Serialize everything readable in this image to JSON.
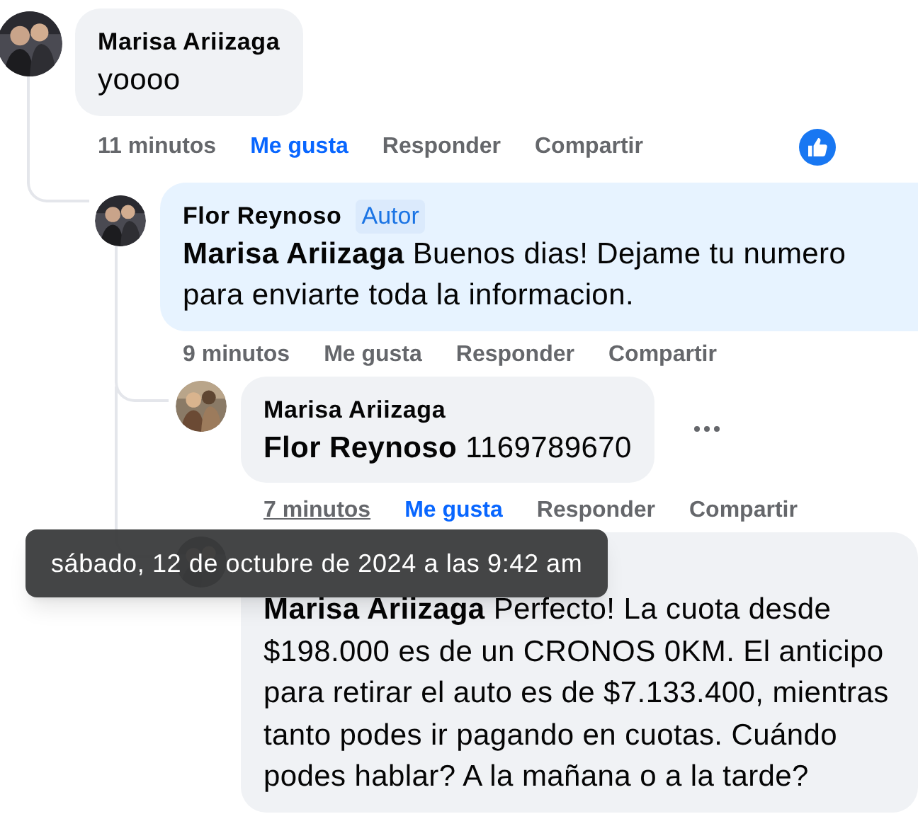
{
  "comments": [
    {
      "author": "Marisa Ariizaga",
      "text": "yoooo",
      "time": "11 minutos",
      "time_hovered": false,
      "liked": true,
      "like_label": "Me gusta",
      "reply_label": "Responder",
      "share_label": "Compartir",
      "has_reactions": true,
      "options_visible": false,
      "children": [
        {
          "author": "Flor Reynoso",
          "badge": "Autor",
          "text": "**Marisa Ariizaga** Buenos dias! Dejame tu numero para enviarte toda la informacion.",
          "time": "9 minutos",
          "time_hovered": false,
          "liked": false,
          "like_label": "Me gusta",
          "reply_label": "Responder",
          "share_label": "Compartir",
          "has_reactions": false,
          "options_visible": false,
          "children": [
            {
              "author": "Marisa Ariizaga",
              "text": "**Flor Reynoso** 1169789670",
              "time": "7 minutos",
              "time_hovered": true,
              "liked": true,
              "like_label": "Me gusta",
              "reply_label": "Responder",
              "share_label": "Compartir",
              "has_reactions": false,
              "options_visible": true
            },
            {
              "text": "**Marisa Ariizaga** Perfecto! La cuota desde $198.000 es de un CRONOS 0KM. El anticipo para retirar el auto es de $7.133.400, mientras tanto podes ir pagando en cuotas. Cuándo podes hablar? A la mañana o a la tarde?"
            }
          ]
        }
      ]
    }
  ],
  "tooltip": {
    "text": "sábado, 12 de octubre de 2024 a las 9:42 am"
  }
}
